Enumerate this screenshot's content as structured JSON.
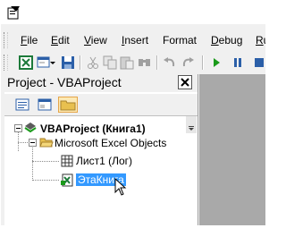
{
  "window": {
    "app_icon": "vba-editor-icon"
  },
  "menubar": {
    "items": [
      {
        "key": "F",
        "rest": "ile"
      },
      {
        "key": "E",
        "rest": "dit"
      },
      {
        "key": "V",
        "rest": "iew"
      },
      {
        "key": "I",
        "rest": "nsert"
      },
      {
        "key": "",
        "rest": "Format"
      },
      {
        "key": "D",
        "rest": "ebug"
      },
      {
        "key": "R",
        "rest": "u"
      }
    ]
  },
  "toolbar": {
    "buttons": [
      "excel-icon",
      "insert-userform-icon",
      "save-icon",
      "cut-icon",
      "copy-icon",
      "paste-icon",
      "find-icon",
      "undo-icon",
      "redo-icon",
      "run-icon",
      "break-icon"
    ]
  },
  "project": {
    "title": "Project - VBAProject",
    "tools": [
      "view-code-icon",
      "view-object-icon",
      "toggle-folders-icon"
    ],
    "tree": {
      "root": "VBAProject (Книга1)",
      "folder": "Microsoft Excel Objects",
      "items": [
        {
          "label": "Лист1 (Лог)",
          "selected": false
        },
        {
          "label": "ЭтаКнига",
          "selected": true
        }
      ]
    }
  },
  "colors": {
    "selection": "#3399ff",
    "code_background": "#a9a9a9",
    "run_green": "#1a9a1a"
  }
}
